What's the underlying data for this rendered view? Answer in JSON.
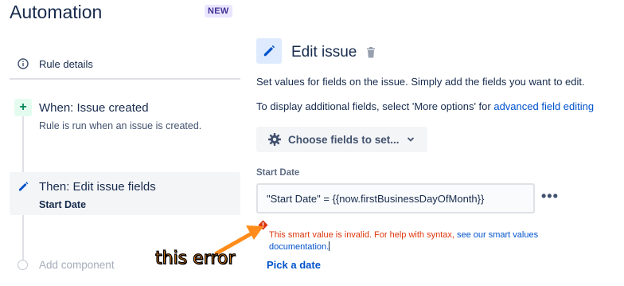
{
  "header": {
    "title": "Automation",
    "badge": "NEW"
  },
  "sidebar": {
    "rule_details": "Rule details",
    "trigger": {
      "title": "When: Issue created",
      "description": "Rule is run when an issue is created."
    },
    "action": {
      "title": "Then: Edit issue fields",
      "subtitle": "Start Date"
    },
    "add_component": "Add component"
  },
  "panel": {
    "title": "Edit issue",
    "desc1": "Set values for fields on the issue. Simply add the fields you want to edit.",
    "desc2_prefix": "To display additional fields, select 'More options' for ",
    "desc2_link": "advanced field editing",
    "choose_button": "Choose fields to set...",
    "field_label": "Start Date",
    "field_value": "\"Start Date\" = {{now.firstBusinessDayOfMonth}}",
    "more_label": "•••",
    "error_prefix": "This smart value is invalid. For help with syntax, ",
    "error_link": "see our smart values documentation.",
    "pick_date": "Pick a date"
  },
  "annotation": {
    "text": "this error",
    "color": "#ff8c1a"
  },
  "colors": {
    "link": "#0052cc",
    "error": "#de350b",
    "badge_bg": "#eae6ff",
    "badge_text": "#403294"
  },
  "icons": [
    "info-icon",
    "plus-icon",
    "pencil-icon",
    "trash-icon",
    "gear-icon",
    "chevron-down-icon",
    "more-icon",
    "error-icon"
  ]
}
